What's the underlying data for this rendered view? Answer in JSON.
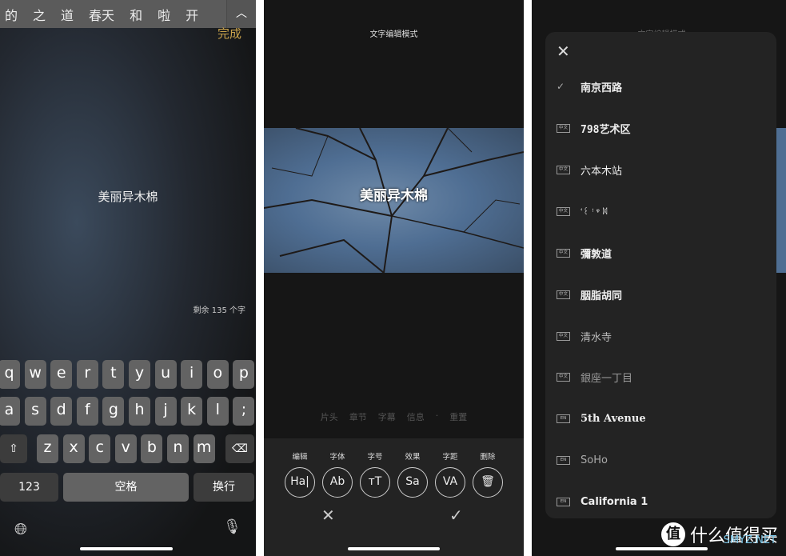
{
  "panel1": {
    "done": "完成",
    "title": "美丽异木棉",
    "remaining": "剩余 135 个字",
    "candidates": [
      "的",
      "之",
      "道",
      "春天",
      "和",
      "啦",
      "开"
    ],
    "rows": [
      [
        "q",
        "w",
        "e",
        "r",
        "t",
        "y",
        "u",
        "i",
        "o",
        "p"
      ],
      [
        "a",
        "s",
        "d",
        "f",
        "g",
        "h",
        "j",
        "k",
        "l",
        ";"
      ],
      [
        "z",
        "x",
        "c",
        "v",
        "b",
        "n",
        "m"
      ]
    ],
    "numbers": "123",
    "space": "空格",
    "return": "换行"
  },
  "panel2": {
    "header": "文字编辑模式",
    "title": "美丽异木棉",
    "tabs": [
      "片头",
      "章节",
      "字幕",
      "信息",
      "·",
      "重置"
    ],
    "tools": [
      {
        "label": "编辑",
        "glyph": "Ha|"
      },
      {
        "label": "字体",
        "glyph": "Ab"
      },
      {
        "label": "字号",
        "glyph": "тT"
      },
      {
        "label": "效果",
        "glyph": "Sa"
      },
      {
        "label": "字距",
        "glyph": "VA"
      },
      {
        "label": "删除",
        "glyph": "🗑"
      }
    ]
  },
  "panel3": {
    "header": "文字编辑模式",
    "fonts": [
      {
        "badge": "",
        "name": "南京西路",
        "selected": true
      },
      {
        "badge": "中文",
        "name": "798艺术区"
      },
      {
        "badge": "中文",
        "name": "六本木站"
      },
      {
        "badge": "中文",
        "name": ""
      },
      {
        "badge": "中文",
        "name": "彌敦道"
      },
      {
        "badge": "中文",
        "name": "胭脂胡同"
      },
      {
        "badge": "中文",
        "name": "清水寺"
      },
      {
        "badge": "中文",
        "name": "銀座一丁目"
      },
      {
        "badge": "EN",
        "name": "5th Avenue"
      },
      {
        "badge": "EN",
        "name": "SoHo"
      },
      {
        "badge": "EN",
        "name": "California 1"
      }
    ]
  },
  "watermark": {
    "logo": "值",
    "text": "什么值得买",
    "sub": "SMYZ.NET"
  }
}
